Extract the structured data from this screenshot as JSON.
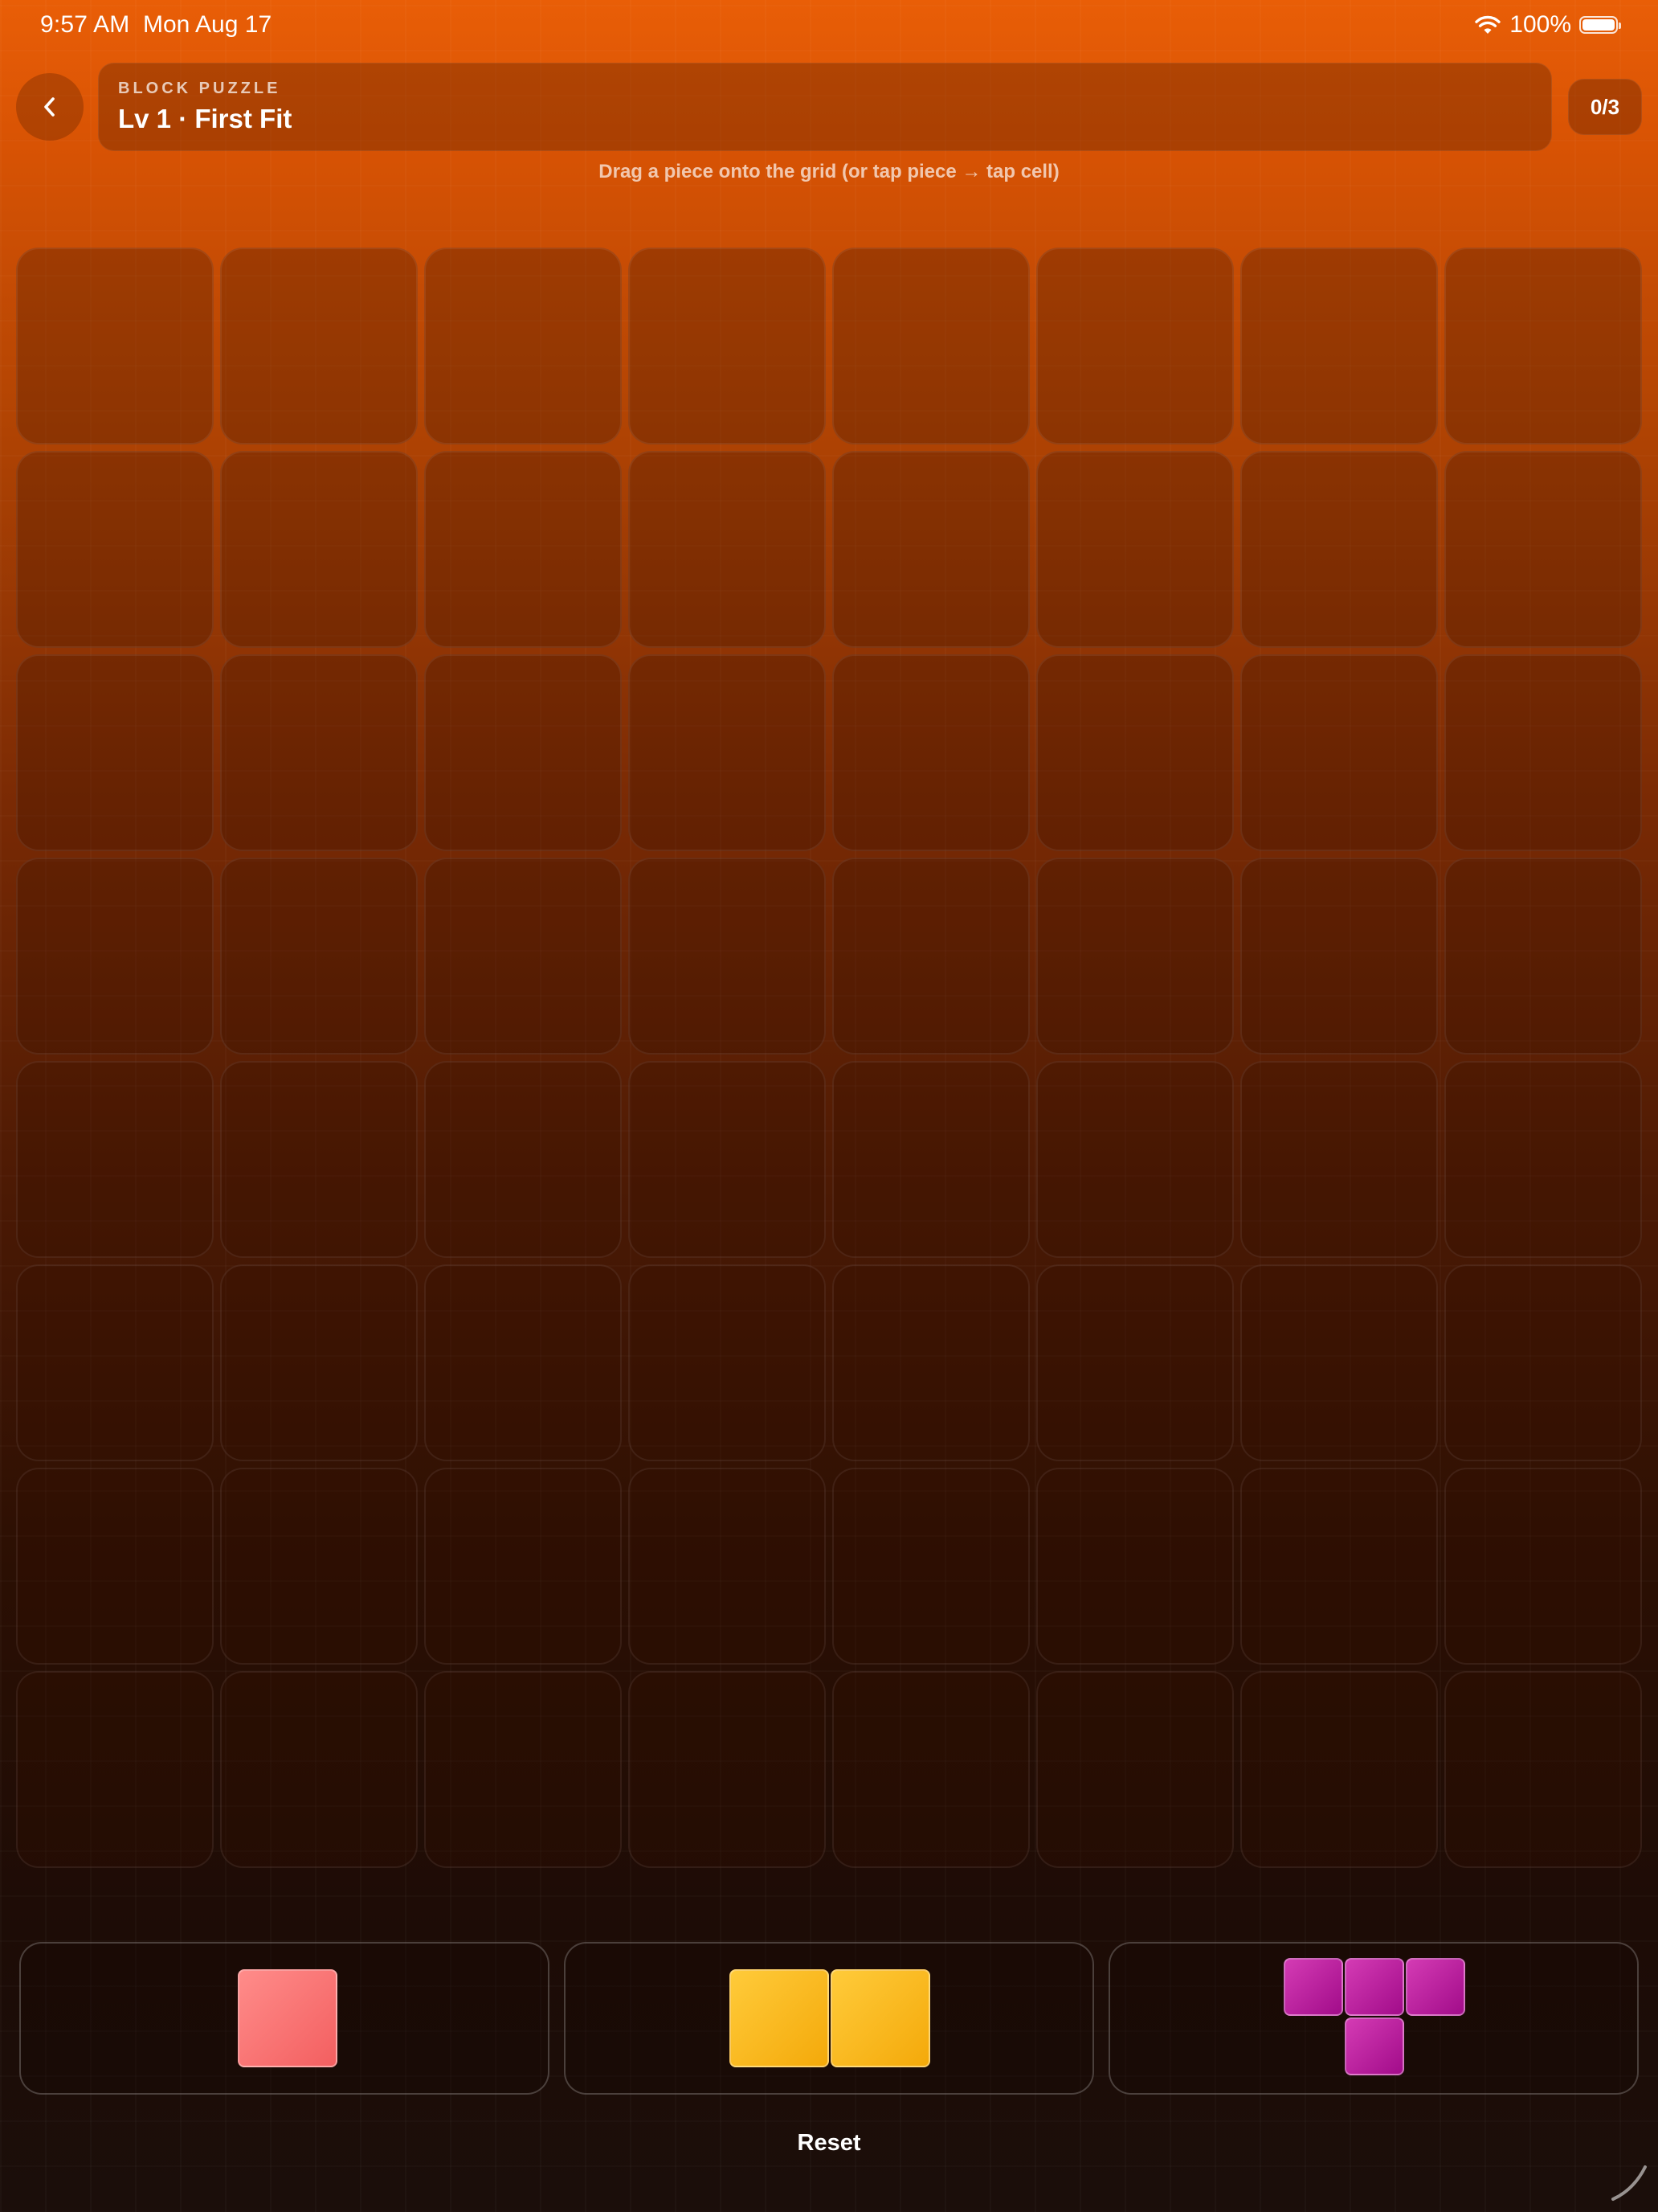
{
  "status_bar": {
    "time": "9:57 AM",
    "date": "Mon Aug 17",
    "battery": "100%"
  },
  "header": {
    "kicker": "BLOCK PUZZLE",
    "title": "Lv 1 · First Fit",
    "score": "0/3"
  },
  "hint": "Drag a piece onto the grid (or tap piece → tap cell)",
  "board": {
    "rows": 8,
    "columns": 8,
    "filled_cells": []
  },
  "pieces": [
    {
      "name": "single",
      "color": "#f66a6a",
      "cells": [
        [
          0,
          0
        ]
      ]
    },
    {
      "name": "domino",
      "color": "#fbb818",
      "cells": [
        [
          0,
          0
        ],
        [
          0,
          1
        ]
      ]
    },
    {
      "name": "t-piece",
      "color": "#b8199d",
      "cells": [
        [
          0,
          0
        ],
        [
          0,
          1
        ],
        [
          0,
          2
        ],
        [
          1,
          1
        ]
      ]
    }
  ],
  "footer": {
    "reset_label": "Reset"
  },
  "colors": {
    "accent_top": "#e95e07",
    "background_bottom": "#1b0e0a"
  }
}
